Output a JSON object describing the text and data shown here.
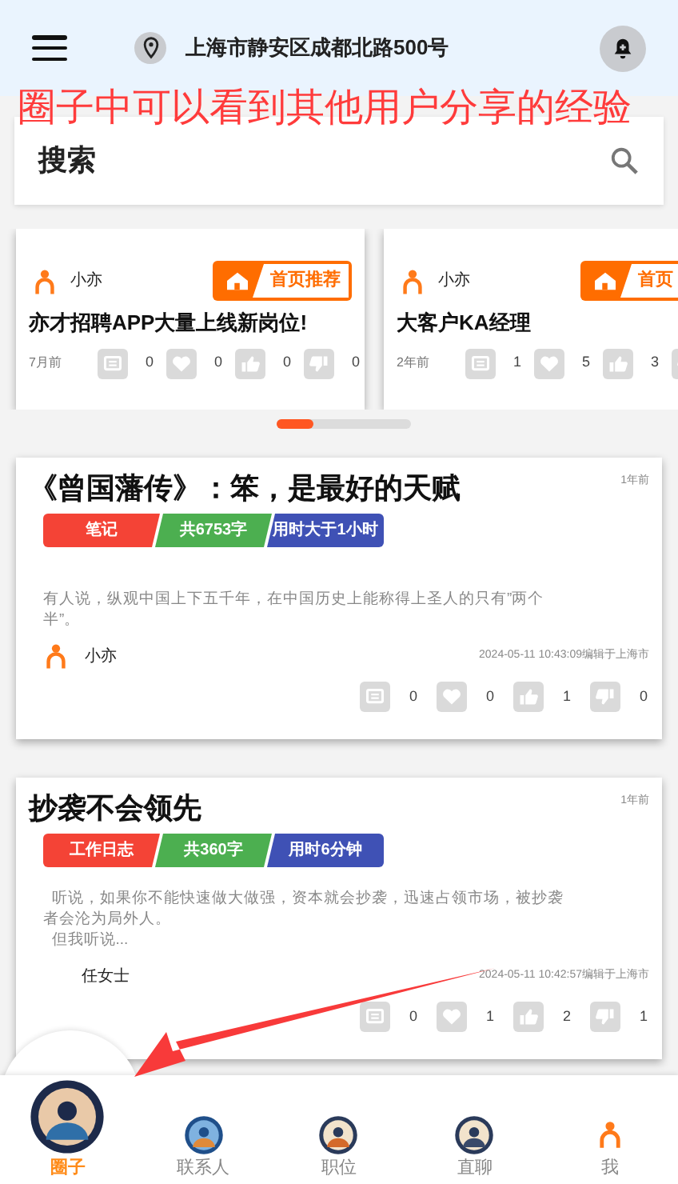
{
  "header": {
    "location": "上海市静安区成都北路500号"
  },
  "annotation": {
    "text": "圈子中可以看到其他用户分享的经验"
  },
  "search": {
    "placeholder": "搜索"
  },
  "featured": [
    {
      "author": "小亦",
      "badge": "首页推荐",
      "title": "亦才招聘APP大量上线新岗位!",
      "time": "7月前",
      "stats": [
        {
          "kind": "comment",
          "count": "0"
        },
        {
          "kind": "favorite",
          "count": "0"
        },
        {
          "kind": "like",
          "count": "0"
        },
        {
          "kind": "dislike",
          "count": "0"
        }
      ]
    },
    {
      "author": "小亦",
      "badge": "首页",
      "title": "大客户KA经理",
      "time": "2年前",
      "stats": [
        {
          "kind": "comment",
          "count": "1"
        },
        {
          "kind": "favorite",
          "count": "5"
        },
        {
          "kind": "like",
          "count": "3"
        },
        {
          "kind": "dislike"
        }
      ]
    }
  ],
  "posts": [
    {
      "title": "《曾国藩传》：笨，是最好的天赋",
      "time": "1年前",
      "tags": [
        {
          "text": "笔记",
          "color": "#f44336"
        },
        {
          "text": "共**6753**字",
          "color": "#4caf50"
        },
        {
          "text": "用时大于**1**小时",
          "color": "#3f51b5"
        }
      ],
      "excerpt": [
        "有人说，纵观中国上下五千年，在中国历史上能称得上圣人的只有”两个半”。"
      ],
      "author": "小亦",
      "author_icon": true,
      "edited": "2024-05-11 10:43:09编辑于上海市",
      "stats": [
        {
          "kind": "comment",
          "count": "0"
        },
        {
          "kind": "favorite",
          "count": "0"
        },
        {
          "kind": "like",
          "count": "1"
        },
        {
          "kind": "dislike",
          "count": "0"
        }
      ]
    },
    {
      "title": "抄袭不会领先",
      "time": "1年前",
      "tags": [
        {
          "text": "工作日志",
          "color": "#f44336"
        },
        {
          "text": "共**360**字",
          "color": "#4caf50"
        },
        {
          "text": "用时**6**分钟",
          "color": "#3f51b5"
        }
      ],
      "excerpt": [
        "  听说，如果你不能快速做大做强，资本就会抄袭，迅速占领市场，被抄袭者会沦为局外人。",
        "  但我听说..."
      ],
      "author": "任女士",
      "author_icon": false,
      "edited": "2024-05-11 10:42:57编辑于上海市",
      "stats": [
        {
          "kind": "comment",
          "count": "0"
        },
        {
          "kind": "favorite",
          "count": "1"
        },
        {
          "kind": "like",
          "count": "2"
        },
        {
          "kind": "dislike",
          "count": "1"
        }
      ]
    }
  ],
  "nav": [
    {
      "label": "圈子",
      "kind": "avatar",
      "selected": true
    },
    {
      "label": "联系人",
      "kind": "avatar",
      "selected": false
    },
    {
      "label": "职位",
      "kind": "avatar",
      "selected": false
    },
    {
      "label": "直聊",
      "kind": "avatar",
      "selected": false
    },
    {
      "label": "我",
      "kind": "person",
      "selected": false
    }
  ]
}
